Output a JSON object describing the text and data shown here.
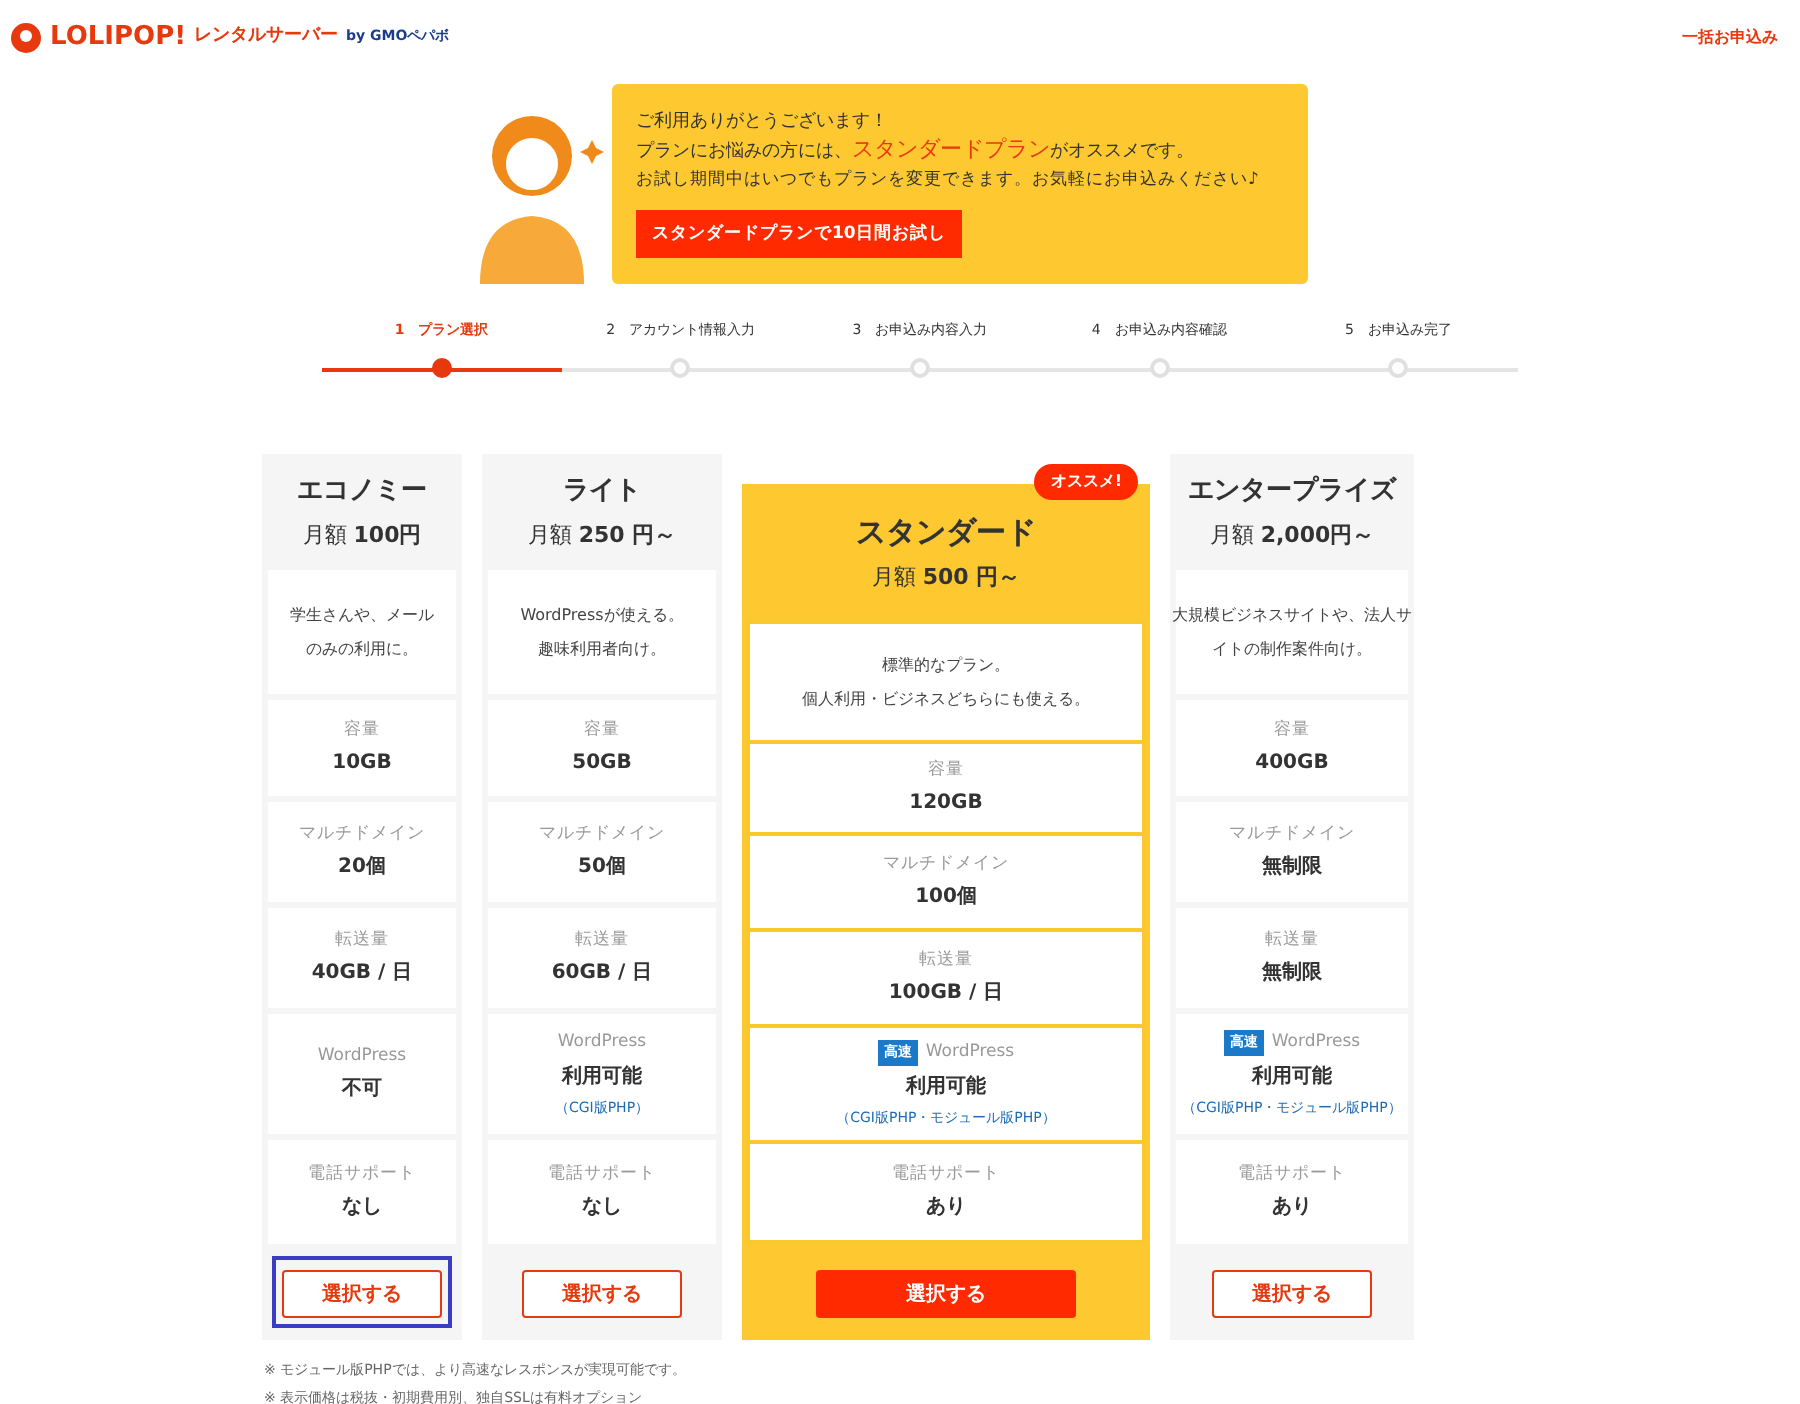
{
  "header": {
    "logo": "LOLIPOP!",
    "service": "レンタルサーバー",
    "by": "by GMOペパボ",
    "link": "一括お申込み"
  },
  "banner": {
    "line1": "ご利用ありがとうございます！",
    "line2": [
      {
        "text": "プランにお悩みの方には、",
        "highlight": false
      },
      {
        "text": "スタンダードプラン",
        "highlight": true
      },
      {
        "text": "がオススメです。",
        "highlight": false
      }
    ],
    "line3": "お試し期間中はいつでもプランを変更できます。お気軽にお申込みください♪",
    "button": "スタンダードプランで10日間お試し"
  },
  "steps": [
    {
      "number": "1",
      "label": "プラン選択",
      "selected": true
    },
    {
      "number": "2",
      "label": "アカウント情報入力",
      "selected": false
    },
    {
      "number": "3",
      "label": "お申込み内容入力",
      "selected": false
    },
    {
      "number": "4",
      "label": "お申込み内容確認",
      "selected": false
    },
    {
      "number": "5",
      "label": "お申込み完了",
      "selected": false
    }
  ],
  "plans": [
    {
      "name": "エコノミー",
      "price_prefix": "月額",
      "price": "100円",
      "featured": false,
      "description": [
        "学生さんや、メール",
        "のみの利用に。"
      ],
      "features": [
        {
          "label": "容量",
          "value": "10GB"
        },
        {
          "label": "マルチドメイン",
          "value": "20個"
        },
        {
          "label": "転送量",
          "value": "40GB / 日"
        },
        {
          "label": "WordPress",
          "value": "不可"
        },
        {
          "label": "電話サポート",
          "value": "なし"
        }
      ],
      "button": "選択する",
      "focused": true
    },
    {
      "name": "ライト",
      "price_prefix": "月額",
      "price": "250 円～",
      "featured": false,
      "description": [
        "WordPressが使える。",
        "趣味利用者向け。"
      ],
      "features": [
        {
          "label": "容量",
          "value": "50GB"
        },
        {
          "label": "マルチドメイン",
          "value": "50個"
        },
        {
          "label": "転送量",
          "value": "60GB / 日"
        },
        {
          "label": "WordPress",
          "value": "利用可能",
          "note": "（CGI版PHP）"
        },
        {
          "label": "電話サポート",
          "value": "なし"
        }
      ],
      "button": "選択する",
      "focused": false
    },
    {
      "name": "スタンダード",
      "price_prefix": "月額",
      "price": "500 円～",
      "featured": true,
      "ribbon": "オススメ!",
      "description": [
        "標準的なプラン。",
        "個人利用・ビジネスどちらにも使える。"
      ],
      "features": [
        {
          "label": "容量",
          "value": "120GB"
        },
        {
          "label": "マルチドメイン",
          "value": "100個"
        },
        {
          "label": "転送量",
          "value": "100GB / 日"
        },
        {
          "label": "WordPress",
          "badge": "高速",
          "value": "利用可能",
          "note": "（CGI版PHP・モジュール版PHP）"
        },
        {
          "label": "電話サポート",
          "value": "あり"
        }
      ],
      "button": "選択する",
      "focused": false
    },
    {
      "name": "エンタープライズ",
      "price_prefix": "月額",
      "price": "2,000円～",
      "featured": false,
      "description": [
        "大規模ビジネスサイトや、法人サ",
        "イトの制作案件向け。"
      ],
      "features": [
        {
          "label": "容量",
          "value": "400GB"
        },
        {
          "label": "マルチドメイン",
          "value": "無制限"
        },
        {
          "label": "転送量",
          "value": "無制限"
        },
        {
          "label": "WordPress",
          "badge": "高速",
          "value": "利用可能",
          "note": "（CGI版PHP・モジュール版PHP）"
        },
        {
          "label": "電話サポート",
          "value": "あり"
        }
      ],
      "button": "選択する",
      "focused": false
    }
  ],
  "notes": [
    "※ モジュール版PHPでは、より高速なレスポンスが実現可能です。",
    "※ 表示価格は税抜・初期費用別、独自SSLは有料オプション"
  ]
}
